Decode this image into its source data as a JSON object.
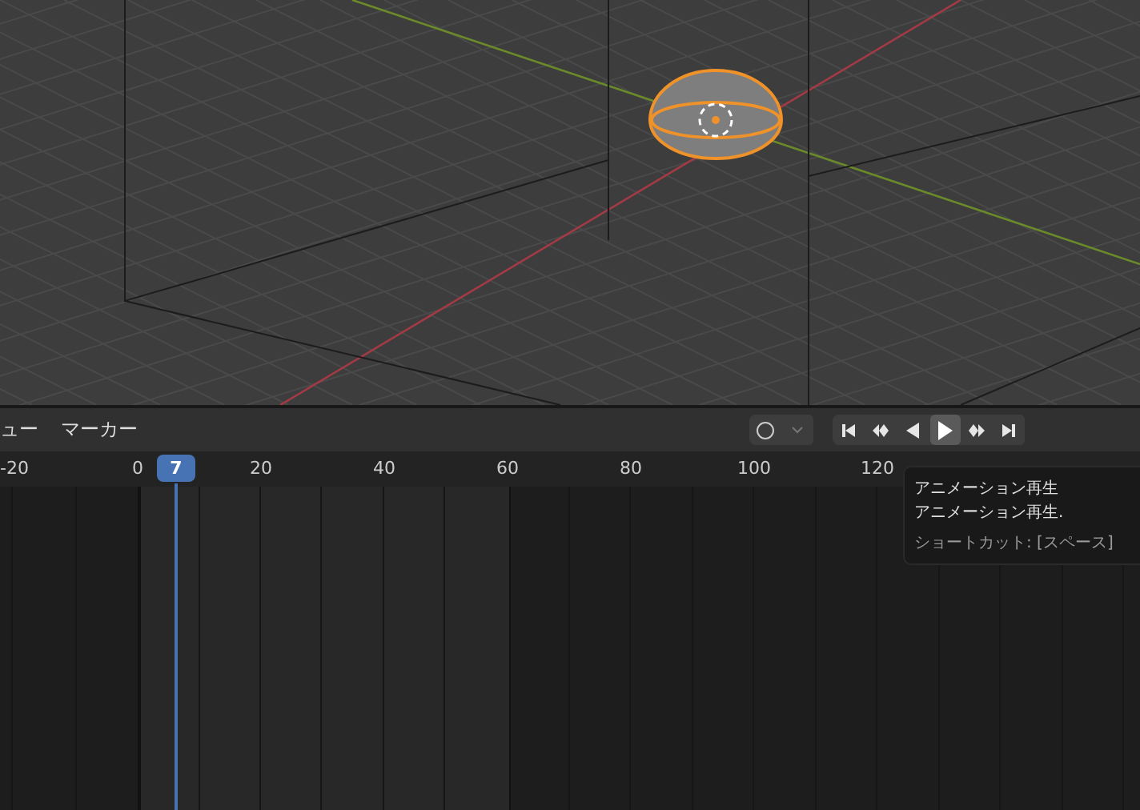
{
  "header": {
    "menus": [
      "ュー",
      "マーカー"
    ],
    "sync_button": {
      "kind": "circle"
    },
    "transport": [
      {
        "kind": "jump-start",
        "highlighted": false
      },
      {
        "kind": "prev-key",
        "highlighted": false
      },
      {
        "kind": "play-reverse",
        "highlighted": false
      },
      {
        "kind": "play",
        "highlighted": true
      },
      {
        "kind": "next-key",
        "highlighted": false
      },
      {
        "kind": "jump-end",
        "highlighted": false
      }
    ]
  },
  "ruler": {
    "ticks": [
      "-20",
      "0",
      "20",
      "40",
      "60",
      "80",
      "100",
      "120"
    ],
    "current_frame": "7"
  },
  "tooltip": {
    "lines": [
      "アニメーション再生",
      "アニメーション再生.",
      "ショートカット: [スペース]"
    ]
  }
}
